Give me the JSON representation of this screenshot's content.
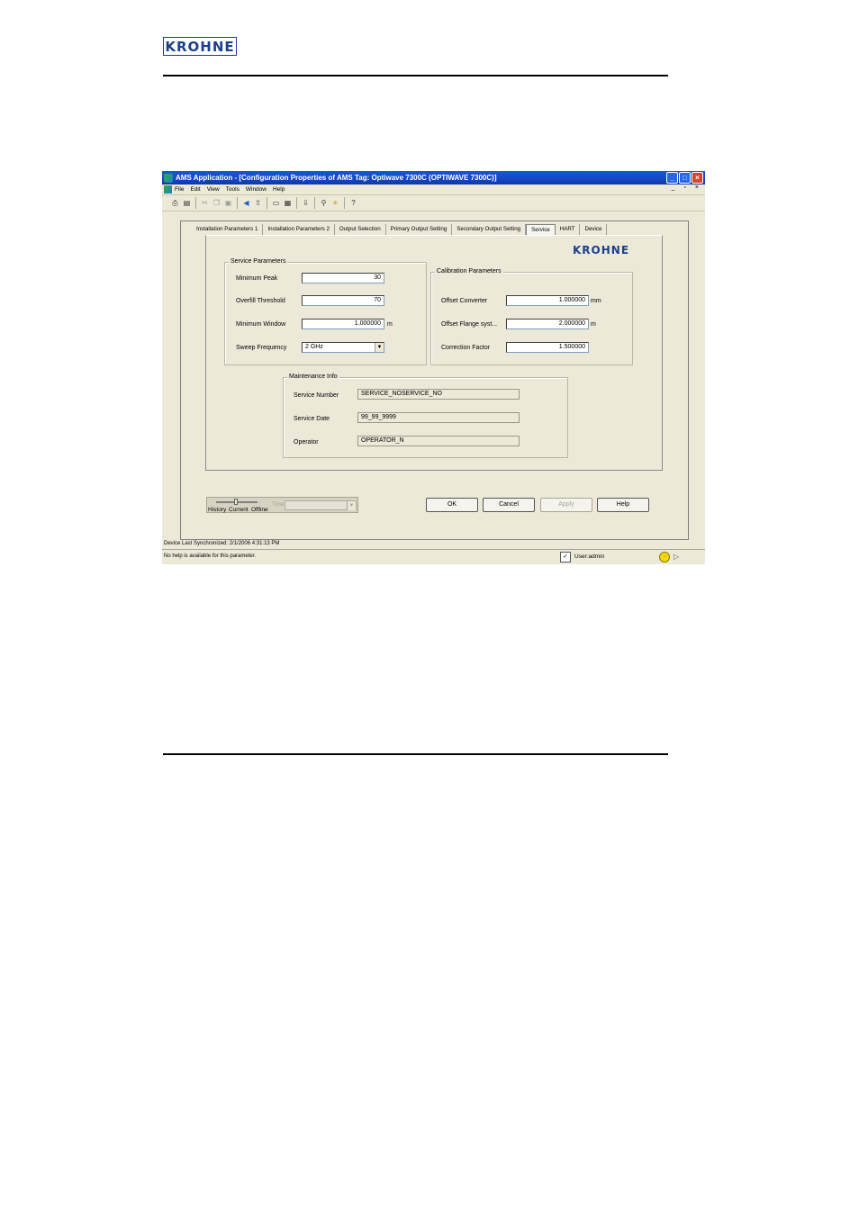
{
  "doc": {
    "logo": "KROHNE"
  },
  "window": {
    "title": "AMS Application - [Configuration Properties of AMS Tag: Optiwave 7300C (OPTIWAVE 7300C)]",
    "menu": [
      "File",
      "Edit",
      "View",
      "Tools",
      "Window",
      "Help"
    ],
    "mdi_controls": "_ ▫ ×"
  },
  "toolbar": {
    "icons": [
      "print-icon",
      "print-preview-icon",
      "cut-icon",
      "copy-icon",
      "paste-icon",
      "back-icon",
      "up-icon",
      "view-icon",
      "grid-icon",
      "download-icon",
      "find-icon",
      "sun-icon",
      "help-icon"
    ]
  },
  "tabs": [
    "Installation Parameters 1",
    "Installation Parameters 2",
    "Output Selection",
    "Primary Output Setting",
    "Secondary Output Setting",
    "Service",
    "HART",
    "Device"
  ],
  "active_tab": "Service",
  "brand": "KROHNE",
  "service_parameters": {
    "title": "Service Parameters",
    "minimum_peak": {
      "label": "Minimum Peak",
      "value": "30"
    },
    "overfill_threshold": {
      "label": "Overfill Threshold",
      "value": "70"
    },
    "minimum_window": {
      "label": "Minimum Window",
      "value": "1.000000",
      "unit": "m"
    },
    "sweep_frequency": {
      "label": "Sweep Frequency",
      "value": "2 GHz"
    }
  },
  "calibration_parameters": {
    "title": "Calibration Parameters",
    "offset_converter": {
      "label": "Offset Converter",
      "value": "1.000000",
      "unit": "mm"
    },
    "offset_flange": {
      "label": "Offset Flange syst...",
      "value": "2.000000",
      "unit": "m"
    },
    "correction_factor": {
      "label": "Correction Factor",
      "value": "1.500000"
    }
  },
  "maintenance_info": {
    "title": "Maintenance Info",
    "service_number": {
      "label": "Service Number",
      "value": "SERVICE_NOSERVICE_NO"
    },
    "service_date": {
      "label": "Service Date",
      "value": "99_99_9999"
    },
    "operator": {
      "label": "Operator",
      "value": "OPERATOR_N"
    }
  },
  "history": {
    "labels": [
      "History",
      "Current",
      "Offline"
    ],
    "time_label": "Time"
  },
  "buttons": {
    "ok": "OK",
    "cancel": "Cancel",
    "apply": "Apply",
    "help": "Help"
  },
  "status": {
    "synchronized": "Device Last Synchronized: 2/1/2006 4:31:13 PM",
    "help_msg": "No help is available for this parameter.",
    "user": "User:admin"
  }
}
